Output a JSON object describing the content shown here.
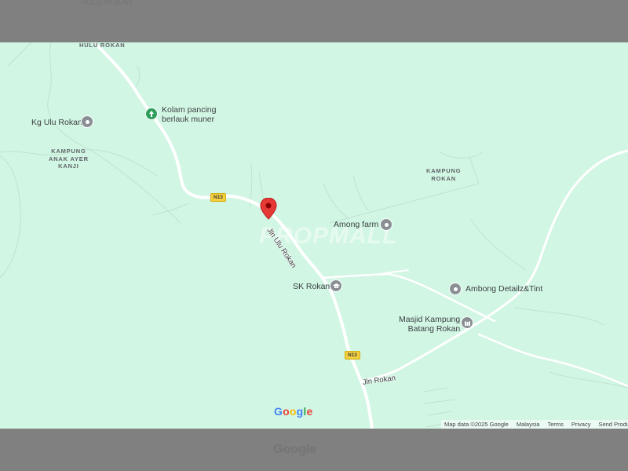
{
  "map": {
    "pin_color": "#e53935",
    "road_color": "#ffffff",
    "land_color": "#d2f6e4",
    "watermark": "PROPMALL",
    "area_labels": {
      "hulu_rokan": "HULU ROKAN",
      "kampung_anak_ayer_kanji": "KAMPUNG\nANAK AYER\nKANJI",
      "kampung_rokan": "KAMPUNG\nROKAN"
    },
    "places": {
      "kg_ulu_rokan": "Kg Ulu Rokan",
      "kolam_pancing": "Kolam pancing\nberlauk muner",
      "among_farm": "Among farm",
      "sk_rokan": "SK Rokan",
      "ambong_detailz": "Ambong Detailz&Tint",
      "masjid": "Masjid Kampung\nBatang Rokan"
    },
    "roads": {
      "shield_1": "N13",
      "shield_2": "N13",
      "jln_ulu_rokan": "Jln Ulu Rokan",
      "jln_rokan": "Jln Rokan"
    },
    "icons": {
      "kg_ulu_rokan": "place-icon",
      "kolam_pancing": "park-icon",
      "among_farm": "place-icon",
      "sk_rokan": "school-icon",
      "ambong_detailz": "place-icon",
      "masjid": "mosque-icon"
    },
    "google_logo": {
      "letters": [
        "G",
        "o",
        "o",
        "g",
        "l",
        "e"
      ],
      "colors": [
        "#4285F4",
        "#EA4335",
        "#FBBC05",
        "#4285F4",
        "#34A853",
        "#EA4335"
      ]
    },
    "attribution": {
      "map_data": "Map data ©2025 Google",
      "region": "Malaysia",
      "terms": "Terms",
      "privacy": "Privacy",
      "send_feedback": "Send Product Feedback"
    }
  }
}
